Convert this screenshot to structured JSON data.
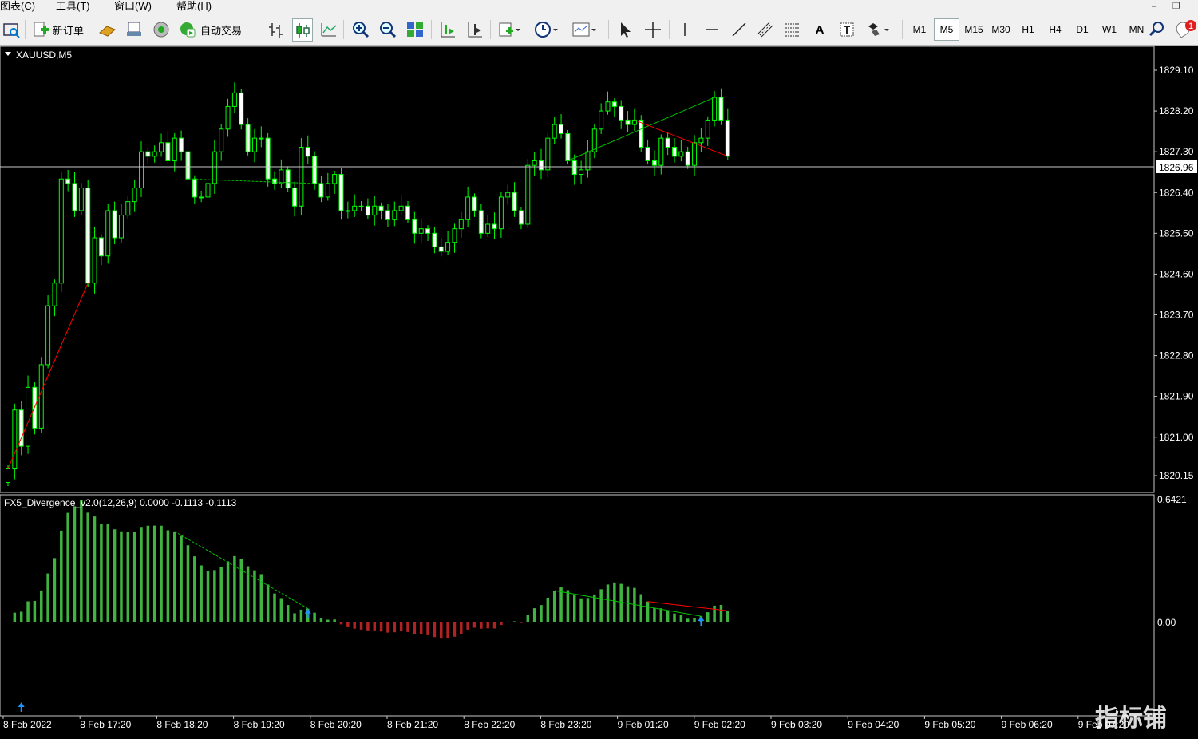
{
  "menu": {
    "items": [
      "图表(C)",
      "工具(T)",
      "窗口(W)",
      "帮助(H)"
    ],
    "window_min": "–",
    "window_restore": "❐"
  },
  "toolbar": {
    "new_order_label": "新订单",
    "auto_trading_label": "自动交易",
    "text_tool_label": "A",
    "timeframes": [
      "M1",
      "M5",
      "M15",
      "M30",
      "H1",
      "H4",
      "D1",
      "W1",
      "MN"
    ],
    "selected_timeframe": "M5",
    "notification_count": "1"
  },
  "chart": {
    "symbol_label": "XAUUSD,M5",
    "current_price_label": "1826.96",
    "price_axis_labels": [
      "1829.10",
      "1828.20",
      "1827.30",
      "1826.40",
      "1825.50",
      "1824.60",
      "1823.70",
      "1822.80",
      "1821.90",
      "1821.00",
      "1820.15"
    ],
    "indicator_label": "FX5_Divergence_v2.0(12,26,9) 0.0000 -0.1113 -0.1113",
    "indicator_axis_labels": [
      "0.6421",
      "0.00"
    ],
    "time_labels": [
      "8 Feb 2022",
      "8 Feb 17:20",
      "8 Feb 18:20",
      "8 Feb 19:20",
      "8 Feb 20:20",
      "8 Feb 21:20",
      "8 Feb 22:20",
      "8 Feb 23:20",
      "9 Feb 01:20",
      "9 Feb 02:20",
      "9 Feb 03:20",
      "9 Feb 04:20",
      "9 Feb 05:20",
      "9 Feb 06:20",
      "9 Feb 07:20"
    ],
    "watermark": "指标铺"
  },
  "colors": {
    "bull_candle": "#00ff00",
    "bear_candle": "#ffffff",
    "histogram_up": "#3fb53f",
    "histogram_down": "#b22222",
    "divergence_bear": "#ff0000",
    "divergence_bull": "#00c000",
    "arrow_up": "#1e90ff",
    "arrow_down": "#ff0000"
  },
  "chart_data": {
    "type": "candlestick",
    "symbol": "XAUUSD",
    "timeframe": "M5",
    "price_range": [
      1820.0,
      1829.5
    ],
    "current_price": 1826.96,
    "closes": [
      1820.3,
      1821.6,
      1820.8,
      1822.1,
      1821.2,
      1822.6,
      1823.9,
      1824.4,
      1826.7,
      1826.6,
      1826.0,
      1826.5,
      1824.4,
      1825.4,
      1825.0,
      1826.0,
      1825.4,
      1825.9,
      1826.2,
      1826.5,
      1827.3,
      1827.2,
      1827.3,
      1827.5,
      1827.1,
      1827.6,
      1827.3,
      1826.7,
      1826.3,
      1826.3,
      1826.6,
      1827.3,
      1827.8,
      1828.3,
      1828.6,
      1827.9,
      1827.3,
      1827.6,
      1827.6,
      1826.7,
      1826.6,
      1826.9,
      1826.5,
      1826.1,
      1827.4,
      1827.2,
      1826.6,
      1826.3,
      1826.6,
      1826.8,
      1826.0,
      1826.0,
      1826.1,
      1826.1,
      1825.9,
      1826.1,
      1826.0,
      1825.8,
      1826.0,
      1826.1,
      1825.8,
      1825.5,
      1825.6,
      1825.5,
      1825.2,
      1825.1,
      1825.3,
      1825.6,
      1825.8,
      1826.3,
      1826.0,
      1825.5,
      1825.7,
      1825.6,
      1826.3,
      1826.4,
      1826.0,
      1825.7,
      1827.0,
      1827.1,
      1826.9,
      1827.6,
      1827.9,
      1827.7,
      1827.1,
      1826.8,
      1826.9,
      1827.3,
      1827.8,
      1828.2,
      1828.4,
      1828.3,
      1828.0,
      1827.9,
      1828.0,
      1827.4,
      1827.1,
      1827.0,
      1827.6,
      1827.4,
      1827.2,
      1827.3,
      1827.0,
      1827.5,
      1827.6,
      1828.0,
      1828.5,
      1828.0,
      1827.2
    ],
    "indicator": {
      "name": "FX5_Divergence_v2.0",
      "params": [
        12,
        26,
        9
      ],
      "values_printed": [
        0.0,
        -0.1113,
        -0.1113
      ],
      "range": [
        -0.42,
        0.6421
      ]
    }
  }
}
